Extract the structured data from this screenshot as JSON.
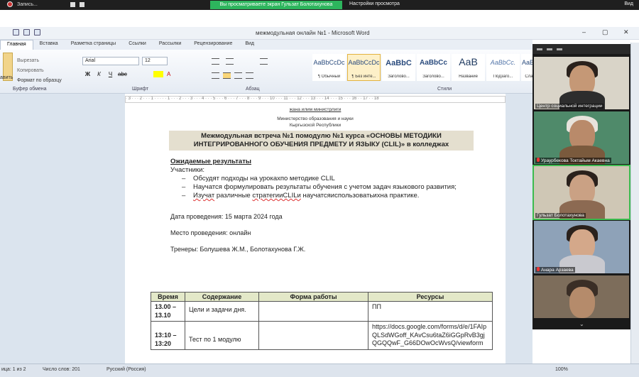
{
  "zoom": {
    "record_label": "Запись...",
    "share_banner": "Вы просматриваете экран Гульзат Болотахунова",
    "view_options": "Настройки просмотра",
    "exit_label": "Вид"
  },
  "window": {
    "title": "межмодульная онлайн №1 - Microsoft Word",
    "minimize": "–",
    "maximize": "▢",
    "close": "✕"
  },
  "ribbon": {
    "tabs": [
      "Главная",
      "Вставка",
      "Разметка страницы",
      "Ссылки",
      "Рассылки",
      "Рецензирование",
      "Вид"
    ],
    "clipboard": {
      "paste": "авить",
      "cut": "Вырезать",
      "copy": "Копировать",
      "format": "Формат по образцу",
      "label": "Буфер обмена"
    },
    "font": {
      "name": "Arial",
      "size": "12",
      "label": "Шрифт"
    },
    "paragraph_label": "Абзац",
    "styles_label": "Стили",
    "styles": [
      {
        "sample": "AaBbCcDc",
        "name": "¶ Обычный"
      },
      {
        "sample": "AaBbCcDc",
        "name": "¶ Без инте..."
      },
      {
        "sample": "AaBbC",
        "name": "Заголово..."
      },
      {
        "sample": "AaBbCc",
        "name": "Заголово..."
      },
      {
        "sample": "АаВ",
        "name": "Название"
      },
      {
        "sample": "AaBbCc.",
        "name": "Подзаго..."
      },
      {
        "sample": "AaBbC",
        "name": "Сла"
      }
    ]
  },
  "ruler_text": "· 3 · · · 2 · · · 1 · · · · · 1 · · · 2 · · · 3 · · · 4 · · · 5 · · · 6 · · · 7 · · · 8 · · · 9 · · · 10 · · · 11 · · · 12 · · · 13 · · · 14 · · · 15 · · · 16 · · 17 · · 18",
  "document": {
    "header_top": "жана илим министрлиги",
    "header_ministry": "Министерство образования и науки",
    "header_country": "Кыргызской Республики",
    "banner": "Межмодульная встреча №1 помодулю №1 курса «ОСНОВЫ МЕТОДИКИ ИНТЕГРИРОВАННОГО ОБУЧЕНИЯ ПРЕДМЕТУ И ЯЗЫКУ (CLIL)» в колледжах",
    "expected_heading": "Ожидаемые результаты",
    "participants": "Участники:",
    "bullets": [
      "Обсудят подходы на урокахпо методике CLIL",
      "Научатся формулировать результаты обучения с учетом задач языкового развития;"
    ],
    "bullet3_a": "Изучат",
    "bullet3_b": " различные ",
    "bullet3_c": "стратегииCLILи",
    "bullet3_d": " научатсяиспользоватьихна практике.",
    "date": "Дата проведения:  15 марта 2024 года",
    "place": "Место проведения: онлайн",
    "trainers": "Тренеры: Болушева Ж.М., Болотахунова Г.Ж.",
    "table": {
      "headers": [
        "Время",
        "Содержание",
        "Форма работы",
        "Ресурсы"
      ],
      "rows": [
        {
          "time": "13.00 – 13.10",
          "content": "Цели и задачи дня.",
          "form": "",
          "resources": "ПП"
        },
        {
          "time": "13:10 – 13:20",
          "content": "Тест по 1 модулю",
          "form": "",
          "resources": "https://docs.google.com/forms/d/e/1FAIpQLSdWGoff_KAvCsu6taZ6iGGpRvB3gjQGQQwF_G66DOwOcWvsQ/viewform"
        }
      ]
    }
  },
  "participants": [
    {
      "name": "Центр социальной интеграции",
      "mic_off": false
    },
    {
      "name": "Ураурбекова Токтайым Акаевна",
      "mic_off": true
    },
    {
      "name": "Гульзат Болотахунова",
      "mic_off": false
    },
    {
      "name": "Анара Арзаева",
      "mic_off": true
    },
    {
      "name": "",
      "mic_off": false
    }
  ],
  "status": {
    "page": "ица: 1 из 2",
    "words": "Число слов: 201",
    "lang": "Русский (Россия)",
    "zoom": "100%"
  }
}
